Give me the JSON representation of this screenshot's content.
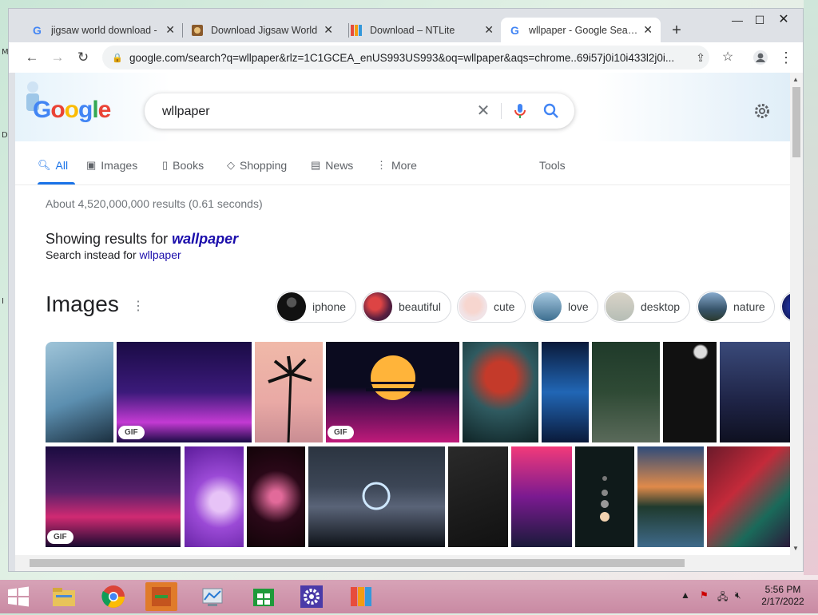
{
  "tabs": [
    {
      "title": "jigsaw world download -",
      "favicon": "google-favicon"
    },
    {
      "title": "Download Jigsaw World",
      "favicon": "jigsaw-favicon"
    },
    {
      "title": "Download – NTLite",
      "favicon": "ntlite-favicon"
    },
    {
      "title": "wllpaper - Google Search",
      "favicon": "google-favicon"
    }
  ],
  "address_url": "google.com/search?q=wllpaper&rlz=1C1GCEA_enUS993US993&oq=wllpaper&aqs=chrome..69i57j0i10i433l2j0i...",
  "search_query": "wllpaper",
  "nav": {
    "all": "All",
    "images": "Images",
    "books": "Books",
    "shopping": "Shopping",
    "news": "News",
    "more": "More",
    "tools": "Tools"
  },
  "results_stats": "About 4,520,000,000 results (0.61 seconds)",
  "correction": {
    "showing_prefix": "Showing results for ",
    "showing_term": "wallpaper",
    "instead_prefix": "Search instead for ",
    "instead_term": "wllpaper"
  },
  "images_section": {
    "heading": "Images",
    "chips": [
      "iphone",
      "beautiful",
      "cute",
      "love",
      "desktop",
      "nature"
    ],
    "gif_label": "GIF"
  },
  "taskbar": {
    "time": "5:56 PM",
    "date": "2/17/2022"
  },
  "colors": {
    "accent": "#1a73e8",
    "link": "#1a0dab",
    "taskbar": "#c98aa3"
  }
}
